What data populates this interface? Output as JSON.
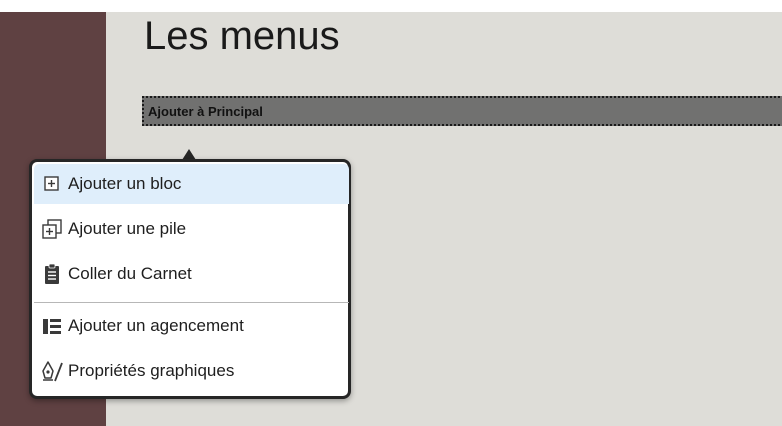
{
  "page": {
    "title": "Les menus"
  },
  "area": {
    "label": "Ajouter à Principal"
  },
  "menu": {
    "items": [
      {
        "label": "Ajouter un bloc",
        "icon": "add-block-icon"
      },
      {
        "label": "Ajouter une pile",
        "icon": "add-stack-icon"
      },
      {
        "label": "Coller du Carnet",
        "icon": "clipboard-icon"
      },
      {
        "label": "Ajouter un agencement",
        "icon": "layout-icon"
      },
      {
        "label": "Propriétés graphiques",
        "icon": "design-pen-icon"
      }
    ]
  },
  "colors": {
    "sidebar": "#5f4142",
    "workspace": "#deddd8",
    "area_bar": "#717170",
    "menu_highlight": "#dfeefb"
  }
}
